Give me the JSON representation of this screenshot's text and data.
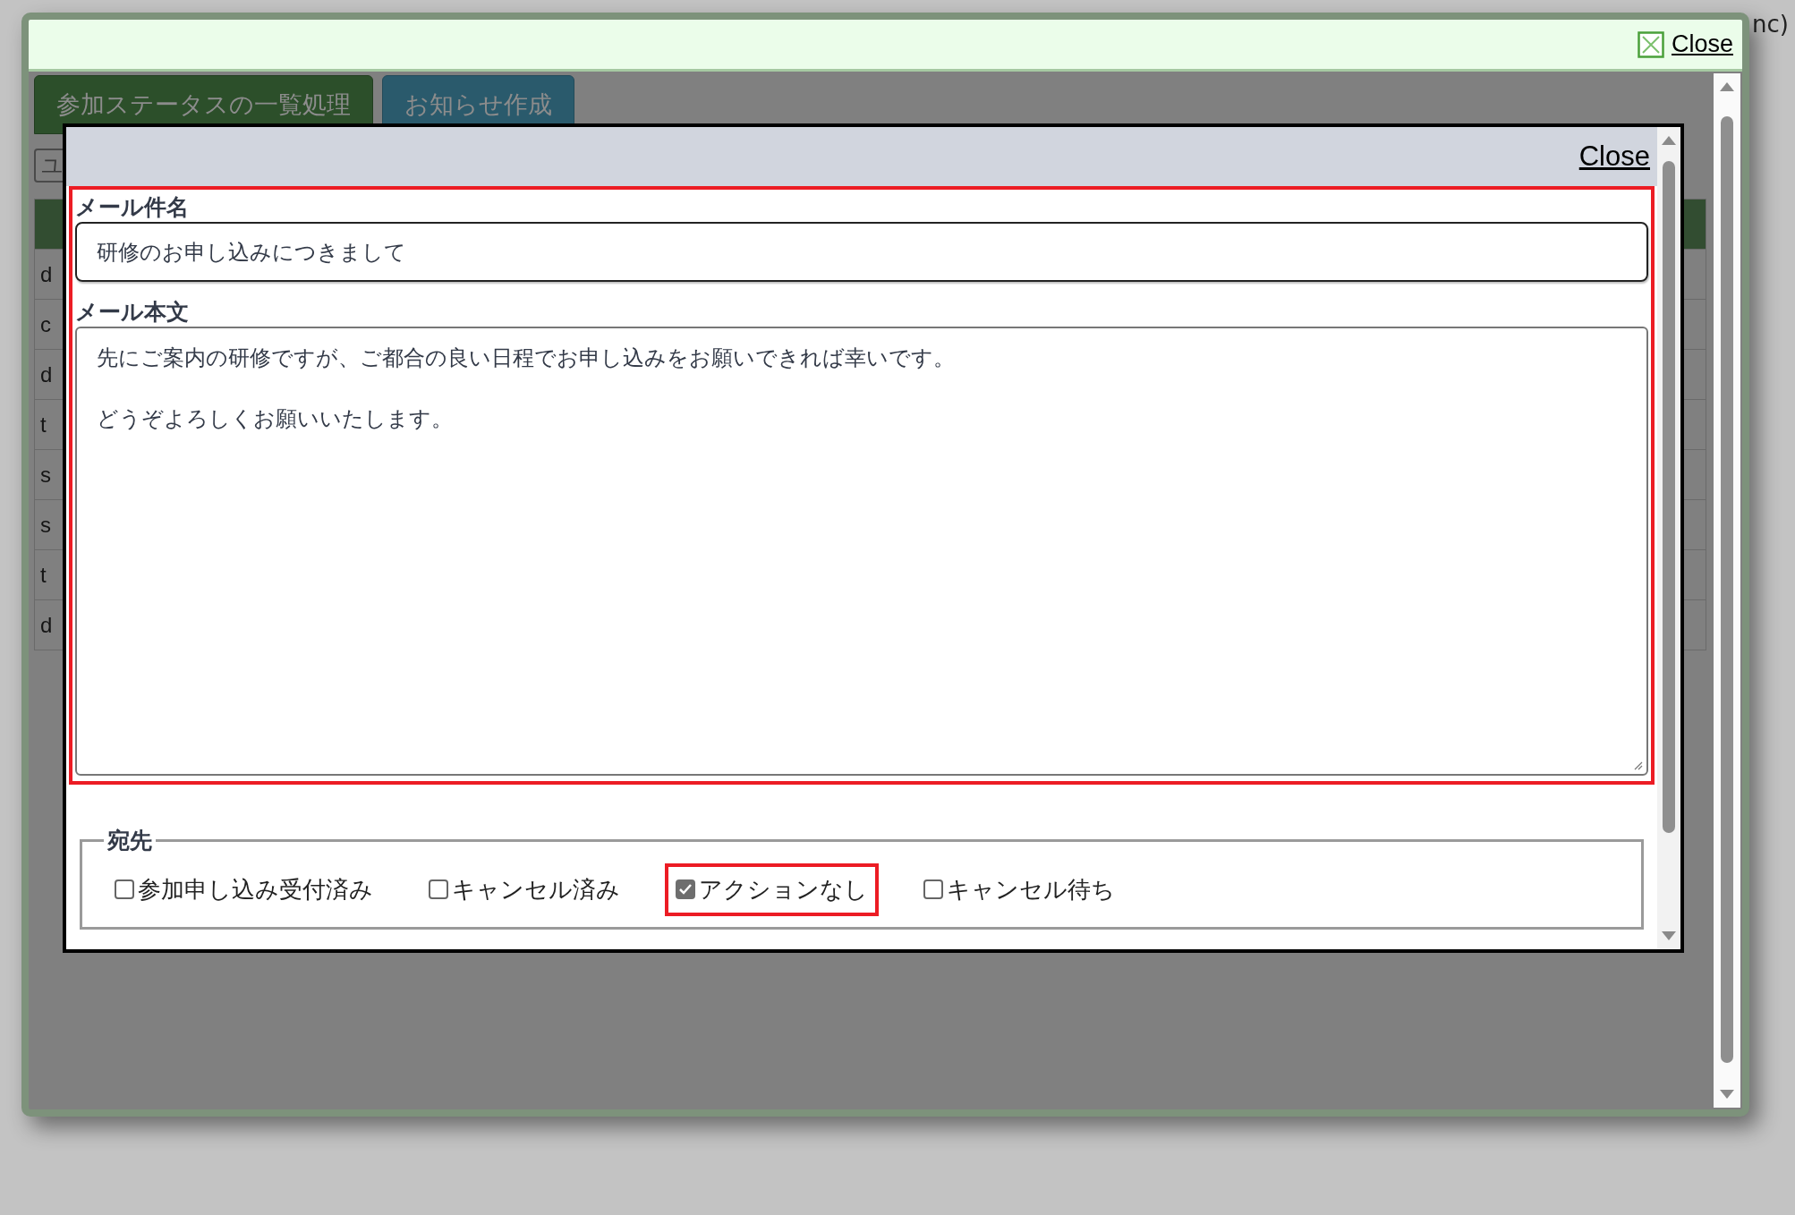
{
  "background_page": {
    "corner_text": "nc)"
  },
  "outer_dialog": {
    "close_link": "Close"
  },
  "tabs": [
    {
      "label": "参加ステータスの一覧処理",
      "selected": true
    },
    {
      "label": "お知らせ作成",
      "selected": false
    }
  ],
  "tool_button": "ユ",
  "table": {
    "rows": [
      {
        "cell": "d"
      },
      {
        "cell": "c"
      },
      {
        "cell": "d"
      },
      {
        "cell": "t"
      },
      {
        "cell": "s"
      },
      {
        "cell": "s"
      },
      {
        "cell": "t"
      },
      {
        "cell": "d"
      }
    ]
  },
  "modal": {
    "close_link": "Close",
    "subject": {
      "label": "メール件名",
      "value": "研修のお申し込みにつきまして"
    },
    "body": {
      "label": "メール本文",
      "paragraphs": [
        "先にご案内の研修ですが、ご都合の良い日程でお申し込みをお願いできれば幸いです。",
        "どうぞよろしくお願いいたします。"
      ]
    },
    "recipients": {
      "legend": "宛先",
      "options": [
        {
          "label": "参加申し込み受付済み",
          "checked": false,
          "highlighted": false
        },
        {
          "label": "キャンセル済み",
          "checked": false,
          "highlighted": false
        },
        {
          "label": "アクションなし",
          "checked": true,
          "highlighted": true
        },
        {
          "label": "キャンセル待ち",
          "checked": false,
          "highlighted": false
        }
      ]
    }
  }
}
